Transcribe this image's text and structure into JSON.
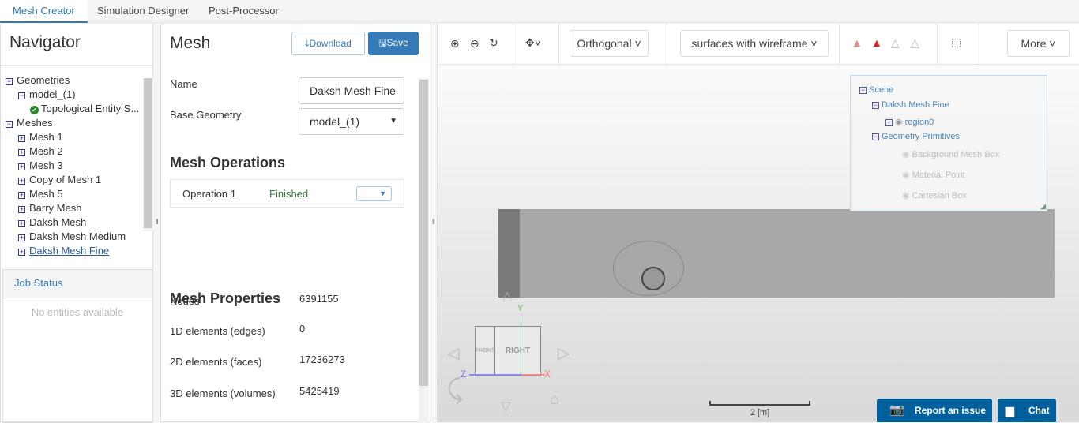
{
  "tabs": [
    "Mesh Creator",
    "Simulation Designer",
    "Post-Processor"
  ],
  "navigator": {
    "title": "Navigator",
    "tree": [
      {
        "label": "Geometries",
        "icon": "minus"
      },
      {
        "label": "model_(1)",
        "icon": "minus"
      },
      {
        "label": "Topological Entity S...",
        "icon": "check"
      },
      {
        "label": "Meshes",
        "icon": "minus"
      },
      {
        "label": "Mesh 1",
        "icon": "plus"
      },
      {
        "label": "Mesh 2",
        "icon": "plus"
      },
      {
        "label": "Mesh 3",
        "icon": "plus"
      },
      {
        "label": "Copy of Mesh 1",
        "icon": "plus"
      },
      {
        "label": "Mesh 5",
        "icon": "plus"
      },
      {
        "label": "Barry Mesh",
        "icon": "plus"
      },
      {
        "label": "Daksh Mesh",
        "icon": "plus"
      },
      {
        "label": "Daksh Mesh Medium",
        "icon": "plus"
      },
      {
        "label": "Daksh Mesh Fine",
        "icon": "plus"
      }
    ],
    "job_status": "Job Status",
    "no_entities": "No entities available"
  },
  "mesh": {
    "title": "Mesh",
    "download": "Download",
    "save": "Save",
    "name_label": "Name",
    "name_value": "Daksh Mesh Fine",
    "base_geometry_label": "Base Geometry",
    "base_geometry_value": "model_(1)",
    "operations_title": "Mesh Operations",
    "operation": {
      "name": "Operation 1",
      "status": "Finished"
    },
    "properties_title": "Mesh Properties",
    "properties": [
      {
        "label": "Nodes",
        "value": "6391155"
      },
      {
        "label": "1D elements (edges)",
        "value": "0"
      },
      {
        "label": "2D elements (faces)",
        "value": "17236273"
      },
      {
        "label": "3D elements (volumes)",
        "value": "5425419"
      }
    ]
  },
  "toolbar": {
    "projection": "Orthogonal",
    "render_mode": "surfaces with wireframe",
    "more": "More"
  },
  "scene": {
    "root": "Scene",
    "mesh": "Daksh Mesh Fine",
    "region": "region0",
    "primitives": "Geometry Primitives",
    "items": [
      "Background Mesh Box",
      "Material Point",
      "Cartesian Box"
    ]
  },
  "viewcube": {
    "front": "FRONT",
    "right": "RIGHT",
    "x": "X",
    "y": "Y",
    "z": "Z"
  },
  "scale": "2 [m]",
  "report": "Report an issue",
  "chat": "Chat",
  "colors": {
    "accent": "#337ab7",
    "footer_button": "#00609c"
  }
}
